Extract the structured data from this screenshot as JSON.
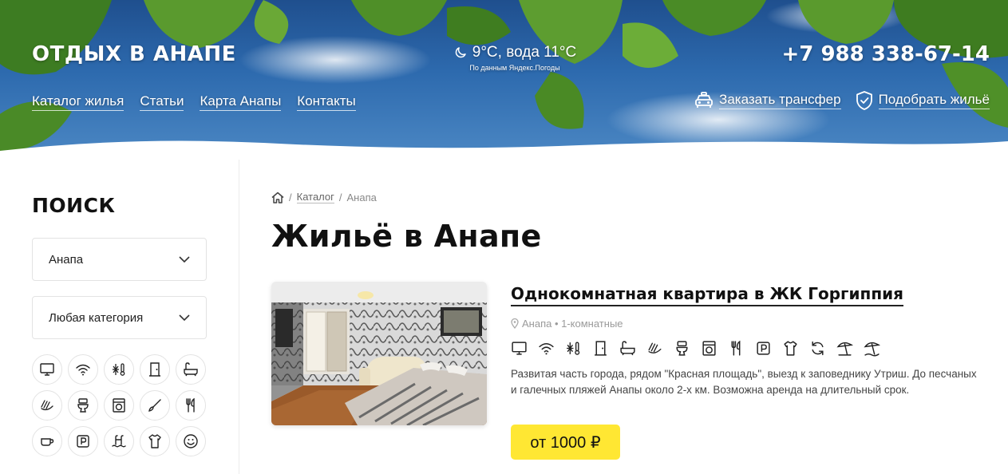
{
  "header": {
    "brand": "ОТДЫХ В АНАПЕ",
    "weather": {
      "main": "9°C, вода 11°C",
      "source": "По данным Яндекс.Погоды",
      "icon": "moon-icon"
    },
    "phone": "+7 988 338-67-14",
    "nav": [
      {
        "label": "Каталог жилья"
      },
      {
        "label": "Статьи"
      },
      {
        "label": "Карта Анапы"
      },
      {
        "label": "Контакты"
      }
    ],
    "actions": [
      {
        "label": "Заказать трансфер",
        "icon": "taxi-icon"
      },
      {
        "label": "Подобрать жильё",
        "icon": "shield-check-icon"
      }
    ]
  },
  "sidebar": {
    "title": "ПОИСК",
    "city_select": {
      "value": "Анапа"
    },
    "category_select": {
      "value": "Любая категория"
    },
    "amenities": [
      "tv-icon",
      "wifi-icon",
      "air-conditioner-icon",
      "door-icon",
      "bathtub-icon",
      "iron-icon",
      "toilet-icon",
      "washing-machine-icon",
      "brush-icon",
      "cutlery-icon",
      "coffee-icon",
      "parking-icon",
      "pool-icon",
      "shirt-icon",
      "smile-icon"
    ]
  },
  "main": {
    "breadcrumbs": {
      "home_icon": "home-icon",
      "catalog": "Каталог",
      "current": "Анапа",
      "sep": "/"
    },
    "title": "Жильё в Анапе",
    "listing": {
      "title": "Однокомнатная квартира в ЖК Горгиппия",
      "meta": "Анапа • 1-комнатные",
      "amenities": [
        "tv-icon",
        "wifi-icon",
        "air-conditioner-icon",
        "door-icon",
        "bathtub-icon",
        "iron-icon",
        "toilet-icon",
        "washing-machine-icon",
        "cutlery-icon",
        "parking-icon",
        "shirt-icon",
        "refresh-icon",
        "beach-umbrella-icon",
        "beach-umbrella-2-icon"
      ],
      "description": "Развитая часть города, рядом \"Красная площадь\", выезд к заповеднику Утриш. До песчаных и галечных пляжей Анапы около 2-х км. Возможна аренда на длительный срок.",
      "price": "от 1000 ₽",
      "price_color": "#ffe733"
    }
  }
}
